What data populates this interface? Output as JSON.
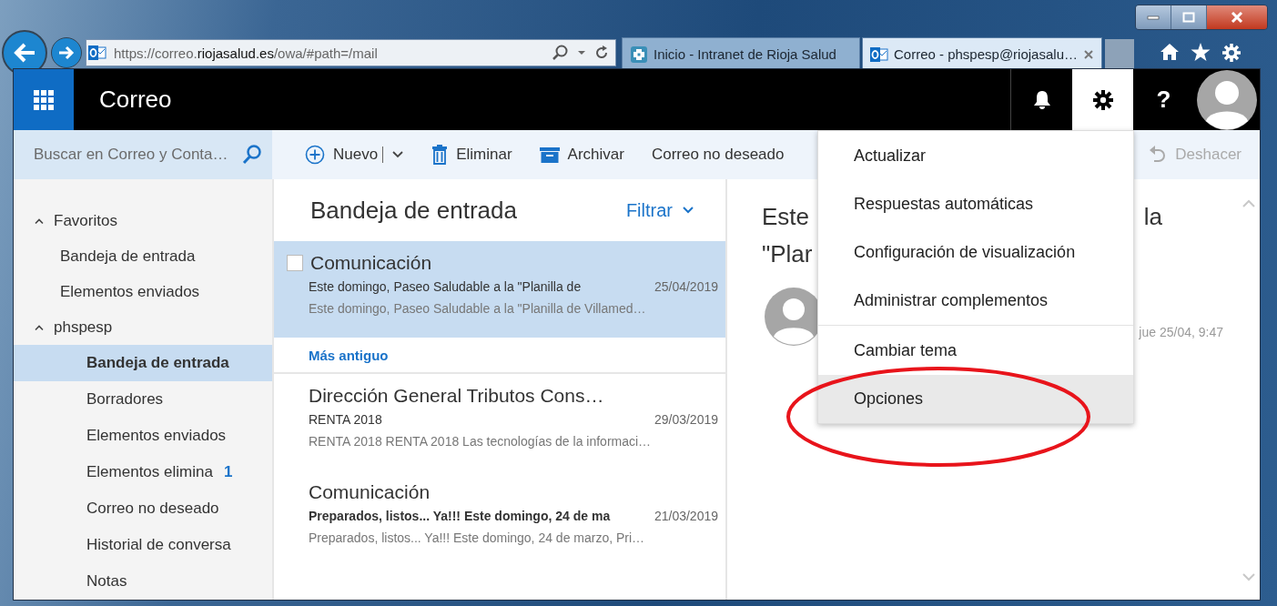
{
  "browser": {
    "address": "https://correo.**riojasalud.es**/owa/#path=/mail",
    "tabs": [
      {
        "kind": "intranet",
        "label": "Inicio - Intranet de Rioja Salud",
        "selected": false
      },
      {
        "kind": "outlook",
        "label": "Correo - phspesp@riojasalu…",
        "selected": true
      }
    ]
  },
  "app": {
    "title": "Correo",
    "header_buttons": [
      {
        "kind": "bell",
        "selected": false
      },
      {
        "kind": "gear",
        "selected": true
      },
      {
        "kind": "help",
        "label": "?",
        "selected": false
      }
    ]
  },
  "search": {
    "placeholder": "Buscar en Correo y Conta…"
  },
  "toolbar": [
    {
      "kind": "new",
      "label": "Nuevo"
    },
    {
      "kind": "delete",
      "label": "Eliminar"
    },
    {
      "kind": "archive",
      "label": "Archivar"
    },
    {
      "kind": "plain",
      "label": "Correo no deseado"
    }
  ],
  "undo": {
    "label": "Deshacer",
    "disabled": true
  },
  "sidebar": [
    {
      "label": "Favoritos",
      "expanded": true,
      "children": [
        {
          "label": "Bandeja de entrada",
          "selected": false
        },
        {
          "label": "Elementos enviados",
          "selected": false
        }
      ]
    },
    {
      "label": "phspesp",
      "expanded": true,
      "children": [
        {
          "label": "Bandeja de entrada",
          "selected": true
        },
        {
          "label": "Borradores",
          "selected": false
        },
        {
          "label": "Elementos enviados",
          "selected": false
        },
        {
          "label": "Elementos elimina",
          "selected": false,
          "count": "1"
        },
        {
          "label": "Correo no deseado",
          "selected": false
        },
        {
          "label": "Historial de conversa",
          "selected": false
        },
        {
          "label": "Notas",
          "selected": false
        }
      ]
    }
  ],
  "message_list": {
    "title": "Bandeja de entrada",
    "filter": "Filtrar",
    "items": [
      {
        "kind": "message",
        "sender": "Comunicación",
        "subject": "Este domingo, Paseo Saludable a la \"Planilla de",
        "date": "25/04/2019",
        "preview": "Este domingo, Paseo Saludable a la \"Planilla de Villamed…",
        "selected": true,
        "unread": false
      },
      {
        "kind": "separator",
        "label": "Más antiguo"
      },
      {
        "kind": "message",
        "sender": "Dirección General Tributos Cons…",
        "subject": "RENTA 2018",
        "date": "29/03/2019",
        "preview": "RENTA 2018 RENTA 2018 Las tecnologías de la informaci…",
        "selected": false,
        "unread": false
      },
      {
        "kind": "message",
        "sender": "Comunicación",
        "subject": "Preparados, listos... Ya!!! Este domingo, 24 de ma",
        "date": "21/03/2019",
        "preview": "Preparados, listos... Ya!!! Este domingo, 24 de marzo, Pri…",
        "selected": false,
        "unread": true
      }
    ]
  },
  "reading_pane": {
    "subject_start": "Este",
    "subject_end": "la",
    "subject_line_2": "\"Plar",
    "time": "jue 25/04, 9:47"
  },
  "settings_menu": [
    {
      "kind": "item",
      "label": "Actualizar",
      "selected": false
    },
    {
      "kind": "item",
      "label": "Respuestas automáticas",
      "selected": false
    },
    {
      "kind": "item",
      "label": "Configuración de visualización",
      "selected": false
    },
    {
      "kind": "item",
      "label": "Administrar complementos",
      "selected": false
    },
    {
      "kind": "divider"
    },
    {
      "kind": "item",
      "label": "Cambiar tema",
      "selected": false
    },
    {
      "kind": "item",
      "label": "Opciones",
      "selected": true
    }
  ]
}
